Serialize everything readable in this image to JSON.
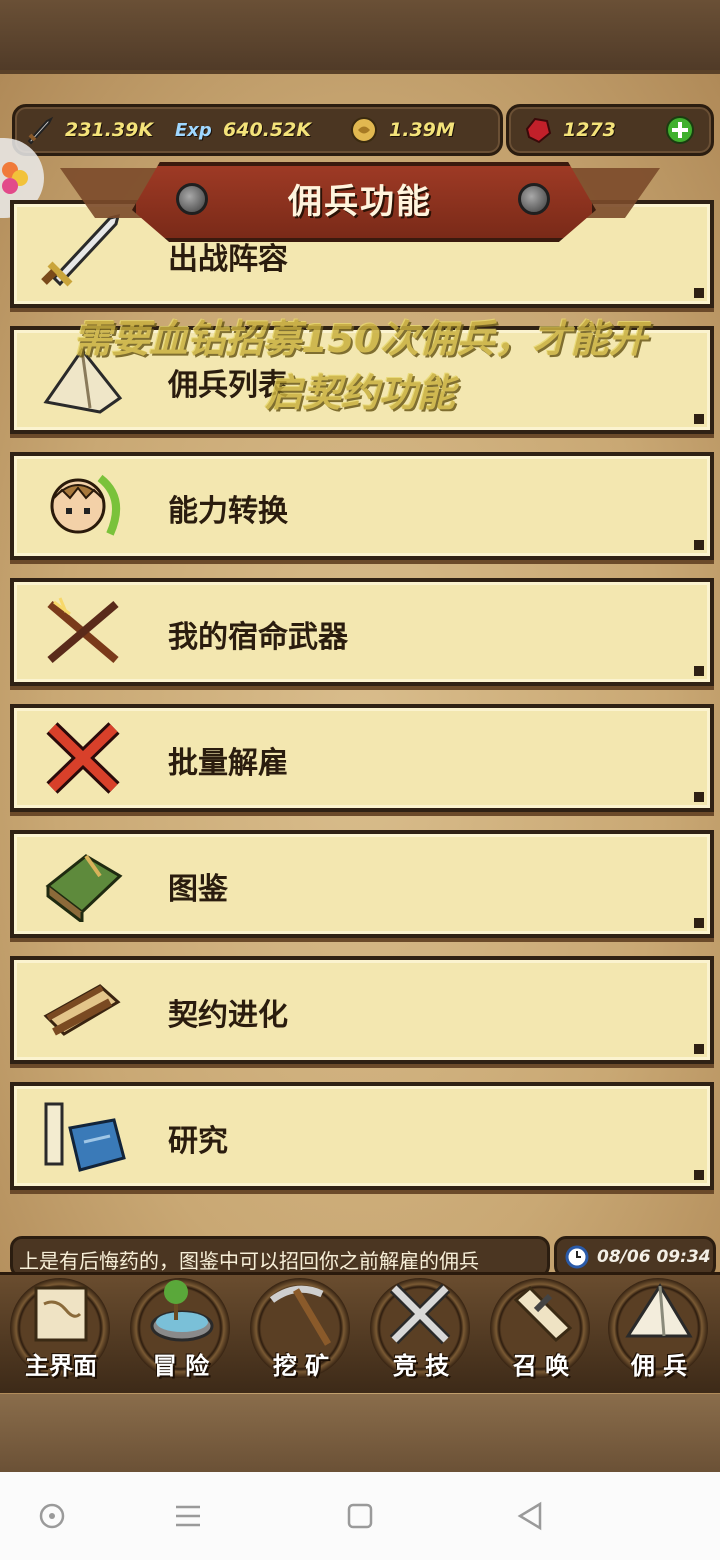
{
  "resources": {
    "attack": "231.39K",
    "exp_icon_label": "Exp",
    "exp": "640.52K",
    "gold": "1.39M",
    "gems": "1273"
  },
  "title": "佣兵功能",
  "menu": [
    {
      "label": "出战阵容",
      "icon": "sword-icon"
    },
    {
      "label": "佣兵列表",
      "icon": "tent-icon"
    },
    {
      "label": "能力转换",
      "icon": "hero-portrait-icon"
    },
    {
      "label": "我的宿命武器",
      "icon": "crossed-weapons-icon"
    },
    {
      "label": "批量解雇",
      "icon": "red-x-icon"
    },
    {
      "label": "图鉴",
      "icon": "green-book-icon"
    },
    {
      "label": "契约进化",
      "icon": "scroll-icon"
    },
    {
      "label": "研究",
      "icon": "candle-book-icon"
    }
  ],
  "toast": {
    "line1": "需要血钻招募150次佣兵，才能开",
    "line2": "启契约功能"
  },
  "ticker": "上是有后悔药的，图鉴中可以招回你之前解雇的佣兵",
  "clock": "08/06 09:34",
  "nav": [
    {
      "label": "主界面"
    },
    {
      "label": "冒 险"
    },
    {
      "label": "挖 矿"
    },
    {
      "label": "竞 技"
    },
    {
      "label": "召 唤"
    },
    {
      "label": "佣 兵"
    }
  ]
}
